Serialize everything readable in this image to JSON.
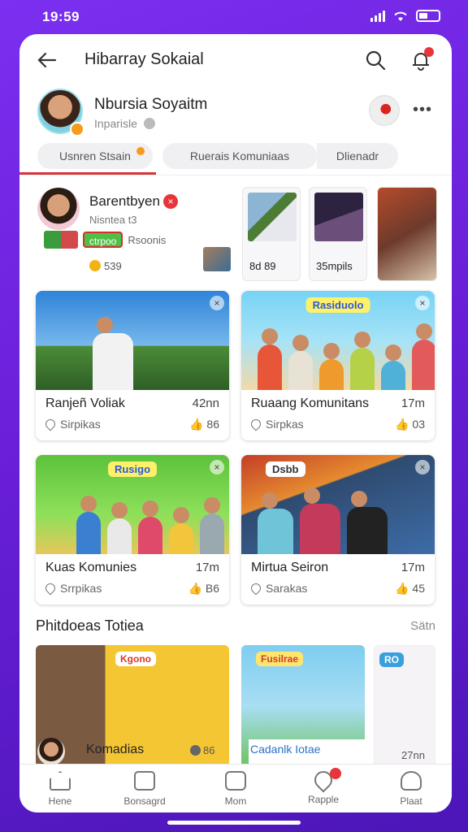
{
  "status_bar": {
    "time": "19:59"
  },
  "header": {
    "title": "Hibarray Sokaial"
  },
  "profile": {
    "name": "Nbursia Soyaitm",
    "subtitle": "Inparisle"
  },
  "tabs": [
    {
      "label": "Usnren Stsain"
    },
    {
      "label": "Ruerais Komuniaas"
    },
    {
      "label": "Dlienadr"
    }
  ],
  "feature": {
    "name": "Barentbyen",
    "subtitle": "Nisntea t3",
    "chip_label": "ctrpoo",
    "chip_text": "Rsoonis",
    "coins": "539",
    "cards": [
      {
        "label": "8d 89"
      },
      {
        "label": "35mpils"
      }
    ]
  },
  "grid": [
    {
      "title": "Ranjeñ Voliak",
      "time": "42nn",
      "like": "Sirpikas",
      "count": "86"
    },
    {
      "title": "Ruaang Komunitans",
      "time": "17m",
      "like": "Sirpkas",
      "count": "03",
      "banner": "Rasiduolo"
    },
    {
      "title": "Kuas Komunies",
      "time": "17m",
      "like": "Srrpikas",
      "count": "B6",
      "banner": "Rusigo"
    },
    {
      "title": "Mirtua Seiron",
      "time": "17m",
      "like": "Sarakas",
      "count": "45",
      "banner": "Dsbb"
    }
  ],
  "section": {
    "title": "Phitdoeas Totiea",
    "more": "Sätn"
  },
  "bottom_cards": [
    {
      "tag": "Kgono"
    },
    {
      "tag": "Fusilrae"
    },
    {
      "tag": "RO"
    }
  ],
  "bottom_row": {
    "name": "Komadias",
    "stat": "86",
    "caption": "Cadanlk Iotae",
    "time": "27nn"
  },
  "nav": [
    {
      "label": "Hene"
    },
    {
      "label": "Bonsagrd"
    },
    {
      "label": "Mom"
    },
    {
      "label": "Rapple"
    },
    {
      "label": "Plaat"
    }
  ]
}
